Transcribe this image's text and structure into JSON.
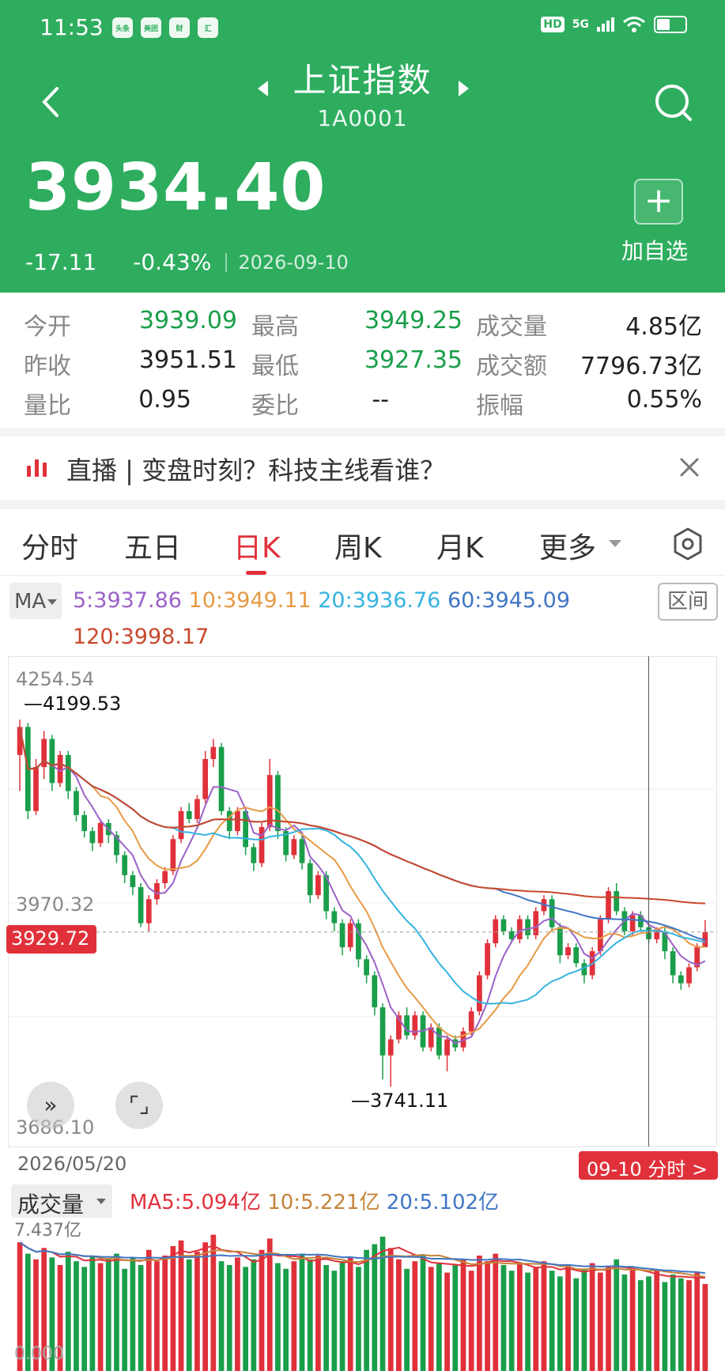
{
  "status": {
    "time": "11:53",
    "apps": [
      "头条",
      "美团",
      "财",
      "汇"
    ],
    "hd": "HD",
    "network": "5G"
  },
  "header": {
    "title": "上证指数",
    "code": "1A0001",
    "price": "3934.40",
    "change": "-17.11",
    "change_pct": "-0.43%",
    "date": "2026-09-10",
    "add_favorite": "加自选"
  },
  "stats": [
    {
      "label": "今开",
      "value": "3939.09",
      "green": true
    },
    {
      "label": "最高",
      "value": "3949.25",
      "green": true
    },
    {
      "label": "成交量",
      "value": "4.85亿",
      "green": false
    },
    {
      "label": "昨收",
      "value": "3951.51",
      "green": false
    },
    {
      "label": "最低",
      "value": "3927.35",
      "green": true
    },
    {
      "label": "成交额",
      "value": "7796.73亿",
      "green": false
    },
    {
      "label": "量比",
      "value": "0.95",
      "green": false
    },
    {
      "label": "委比",
      "value": "--",
      "green": false
    },
    {
      "label": "振幅",
      "value": "0.55%",
      "green": false
    }
  ],
  "banner": {
    "text": "直播 | 变盘时刻？科技主线看谁？"
  },
  "tabs": [
    "分时",
    "五日",
    "日K",
    "周K",
    "月K",
    "更多"
  ],
  "active_tab": "日K",
  "ma": {
    "selector": "MA",
    "ma5": "5:3937.86",
    "ma10": "10:3949.11",
    "ma20": "20:3936.76",
    "ma60": "60:3945.09",
    "ma120": "120:3998.17",
    "range_button": "区间"
  },
  "chart": {
    "top": "4254.54",
    "mid": "3970.32",
    "bottom": "3686.10",
    "high_mark": "4199.53",
    "low_mark": "3741.11",
    "current_tag": "3929.72",
    "start_date": "2026/05/20",
    "end_tag": "09-10 分时 >"
  },
  "volume": {
    "selector": "成交量",
    "ma5": "MA5:5.094亿",
    "ma10": "10:5.221亿",
    "ma20": "20:5.102亿",
    "max": "7.437亿",
    "min": "0.000"
  },
  "colors": {
    "header_green": "#2ead5f",
    "up_red": "#e0313b",
    "down_green": "#1a9e4a"
  },
  "chart_data": {
    "type": "candlestick",
    "ylim": [
      3686.1,
      4254.54
    ],
    "candles": [
      [
        4155,
        4190,
        4110,
        4199
      ],
      [
        4190,
        4085,
        4075,
        4195
      ],
      [
        4085,
        4140,
        4080,
        4150
      ],
      [
        4140,
        4175,
        4125,
        4185
      ],
      [
        4175,
        4120,
        4110,
        4180
      ],
      [
        4120,
        4155,
        4115,
        4160
      ],
      [
        4155,
        4110,
        4100,
        4160
      ],
      [
        4110,
        4080,
        4072,
        4115
      ],
      [
        4080,
        4060,
        4052,
        4085
      ],
      [
        4060,
        4045,
        4035,
        4065
      ],
      [
        4045,
        4070,
        4040,
        4075
      ],
      [
        4070,
        4055,
        4045,
        4075
      ],
      [
        4055,
        4030,
        4020,
        4060
      ],
      [
        4030,
        4005,
        3995,
        4035
      ],
      [
        4005,
        3990,
        3980,
        4010
      ],
      [
        3990,
        3945,
        3940,
        3995
      ],
      [
        3945,
        3975,
        3935,
        3980
      ],
      [
        3975,
        3995,
        3968,
        4000
      ],
      [
        3995,
        4010,
        3988,
        4015
      ],
      [
        4010,
        4050,
        4005,
        4055
      ],
      [
        4050,
        4085,
        4045,
        4090
      ],
      [
        4085,
        4075,
        4070,
        4095
      ],
      [
        4075,
        4100,
        4070,
        4105
      ],
      [
        4100,
        4150,
        4095,
        4160
      ],
      [
        4150,
        4165,
        4140,
        4175
      ],
      [
        4165,
        4085,
        4080,
        4170
      ],
      [
        4085,
        4060,
        4050,
        4090
      ],
      [
        4060,
        4085,
        4055,
        4090
      ],
      [
        4085,
        4040,
        4030,
        4088
      ],
      [
        4040,
        4020,
        4010,
        4045
      ],
      [
        4020,
        4065,
        4015,
        4070
      ],
      [
        4065,
        4130,
        4060,
        4150
      ],
      [
        4130,
        4060,
        4050,
        4135
      ],
      [
        4060,
        4030,
        4022,
        4065
      ],
      [
        4030,
        4050,
        4025,
        4055
      ],
      [
        4050,
        4020,
        4012,
        4055
      ],
      [
        4020,
        3980,
        3970,
        4025
      ],
      [
        3980,
        4005,
        3975,
        4010
      ],
      [
        4005,
        3960,
        3950,
        4010
      ],
      [
        3960,
        3945,
        3935,
        3965
      ],
      [
        3945,
        3915,
        3905,
        3950
      ],
      [
        3915,
        3945,
        3910,
        3950
      ],
      [
        3945,
        3900,
        3890,
        3950
      ],
      [
        3900,
        3880,
        3870,
        3905
      ],
      [
        3880,
        3840,
        3830,
        3885
      ],
      [
        3840,
        3780,
        3750,
        3845
      ],
      [
        3780,
        3800,
        3741,
        3805
      ],
      [
        3800,
        3830,
        3795,
        3835
      ],
      [
        3830,
        3805,
        3800,
        3840
      ],
      [
        3805,
        3830,
        3800,
        3835
      ],
      [
        3830,
        3790,
        3785,
        3835
      ],
      [
        3790,
        3815,
        3785,
        3820
      ],
      [
        3815,
        3780,
        3775,
        3820
      ],
      [
        3780,
        3800,
        3760,
        3805
      ],
      [
        3800,
        3790,
        3785,
        3805
      ],
      [
        3790,
        3810,
        3785,
        3815
      ],
      [
        3810,
        3835,
        3805,
        3840
      ],
      [
        3835,
        3880,
        3830,
        3885
      ],
      [
        3880,
        3920,
        3875,
        3925
      ],
      [
        3920,
        3950,
        3915,
        3955
      ],
      [
        3950,
        3935,
        3930,
        3955
      ],
      [
        3935,
        3925,
        3920,
        3940
      ],
      [
        3925,
        3950,
        3920,
        3955
      ],
      [
        3950,
        3930,
        3925,
        3955
      ],
      [
        3930,
        3960,
        3925,
        3965
      ],
      [
        3960,
        3975,
        3955,
        3980
      ],
      [
        3975,
        3940,
        3935,
        3980
      ],
      [
        3940,
        3905,
        3895,
        3945
      ],
      [
        3905,
        3915,
        3900,
        3920
      ],
      [
        3915,
        3895,
        3890,
        3920
      ],
      [
        3895,
        3880,
        3870,
        3900
      ],
      [
        3880,
        3910,
        3875,
        3915
      ],
      [
        3910,
        3950,
        3905,
        3955
      ],
      [
        3950,
        3985,
        3945,
        3990
      ],
      [
        3985,
        3960,
        3955,
        3995
      ],
      [
        3960,
        3935,
        3930,
        3965
      ],
      [
        3935,
        3955,
        3930,
        3960
      ],
      [
        3955,
        3940,
        3935,
        3960
      ],
      [
        3940,
        3925,
        3920,
        3945
      ],
      [
        3925,
        3935,
        3920,
        3940
      ],
      [
        3935,
        3910,
        3900,
        3940
      ],
      [
        3910,
        3880,
        3870,
        3915
      ],
      [
        3880,
        3870,
        3862,
        3885
      ],
      [
        3870,
        3890,
        3865,
        3895
      ],
      [
        3890,
        3915,
        3885,
        3920
      ],
      [
        3915,
        3934,
        3927,
        3949
      ]
    ],
    "volume_range": [
      0,
      7.437
    ],
    "volumes": [
      6.8,
      6.2,
      5.9,
      6.5,
      6.0,
      5.6,
      6.3,
      5.8,
      5.5,
      6.1,
      5.7,
      5.9,
      6.2,
      5.4,
      6.0,
      5.6,
      6.4,
      5.8,
      6.1,
      6.6,
      6.9,
      5.9,
      6.3,
      6.8,
      7.2,
      5.8,
      5.6,
      6.0,
      5.5,
      5.9,
      6.4,
      7.0,
      5.7,
      5.4,
      5.8,
      6.2,
      5.9,
      6.1,
      5.6,
      5.3,
      5.8,
      6.0,
      5.5,
      6.4,
      6.7,
      7.1,
      6.5,
      5.9,
      5.4,
      5.8,
      6.1,
      5.5,
      5.7,
      5.2,
      5.6,
      5.9,
      5.3,
      6.1,
      5.8,
      6.2,
      5.6,
      5.3,
      5.7,
      5.2,
      5.5,
      5.8,
      5.3,
      5.0,
      5.6,
      4.9,
      5.4,
      5.7,
      5.2,
      5.5,
      5.9,
      5.1,
      5.4,
      4.8,
      5.0,
      5.3,
      4.7,
      5.1,
      4.9,
      4.8,
      5.2,
      4.6
    ]
  }
}
